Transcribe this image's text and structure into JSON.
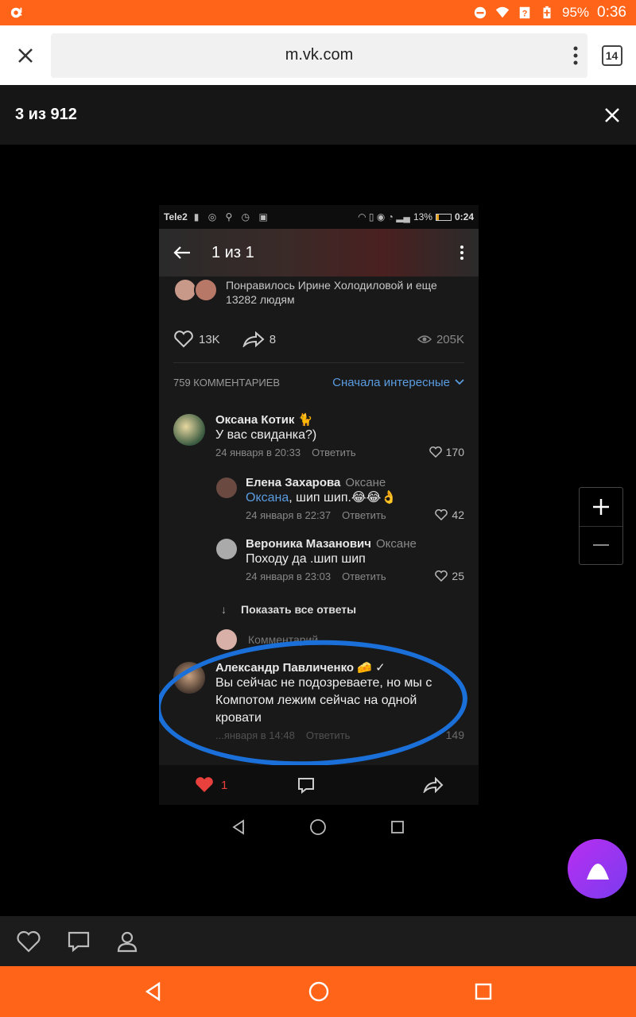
{
  "status_bar": {
    "battery": "95%",
    "time": "0:36"
  },
  "browser": {
    "url": "m.vk.com",
    "tab_count": "14"
  },
  "viewer": {
    "counter": "3 из 912"
  },
  "photo": {
    "status_bar": {
      "carrier": "Tele2",
      "battery": "13%",
      "time": "0:24"
    },
    "toolbar_title": "1 из 1",
    "likes_text": "Понравилось Ирине Холодиловой и еще 13282 людям",
    "likes_count": "13K",
    "shares_count": "8",
    "views_count": "205K",
    "comments_count_label": "759 КОММЕНТАРИЕВ",
    "sort_label": "Сначала интересные",
    "comments": [
      {
        "author": "Оксана Котик 🐈",
        "to": "",
        "mention": "",
        "text": "У вас свиданка?)",
        "date": "24 января в 20:33",
        "reply_label": "Ответить",
        "likes": "170"
      },
      {
        "author": "Елена Захарова",
        "to": "Оксане",
        "mention": "Оксана",
        "text": ", шип шип.😂😂👌",
        "date": "24 января в 22:37",
        "reply_label": "Ответить",
        "likes": "42"
      },
      {
        "author": "Вероника Мазанович",
        "to": "Оксане",
        "mention": "",
        "text": "Походу да .шип шип",
        "date": "24 января в 23:03",
        "reply_label": "Ответить",
        "likes": "25"
      },
      {
        "author": "Александр Павличенко 🧀 ✓",
        "to": "",
        "mention": "",
        "text": "Вы сейчас не подозреваете, но мы с Компотом лежим сейчас на одной кровати",
        "date": "...января в 14:48",
        "reply_label": "Ответить",
        "likes": "149"
      }
    ],
    "show_all_label": "Показать все ответы",
    "comment_placeholder": "Комментарий",
    "bottom_like_count": "1"
  },
  "colors": {
    "orange": "#ff6418",
    "vk_blue": "#5a9ce0",
    "alice_purple": "#8a36f0",
    "heart_red": "#e8403c",
    "annotation_blue": "#1a6fd8"
  }
}
